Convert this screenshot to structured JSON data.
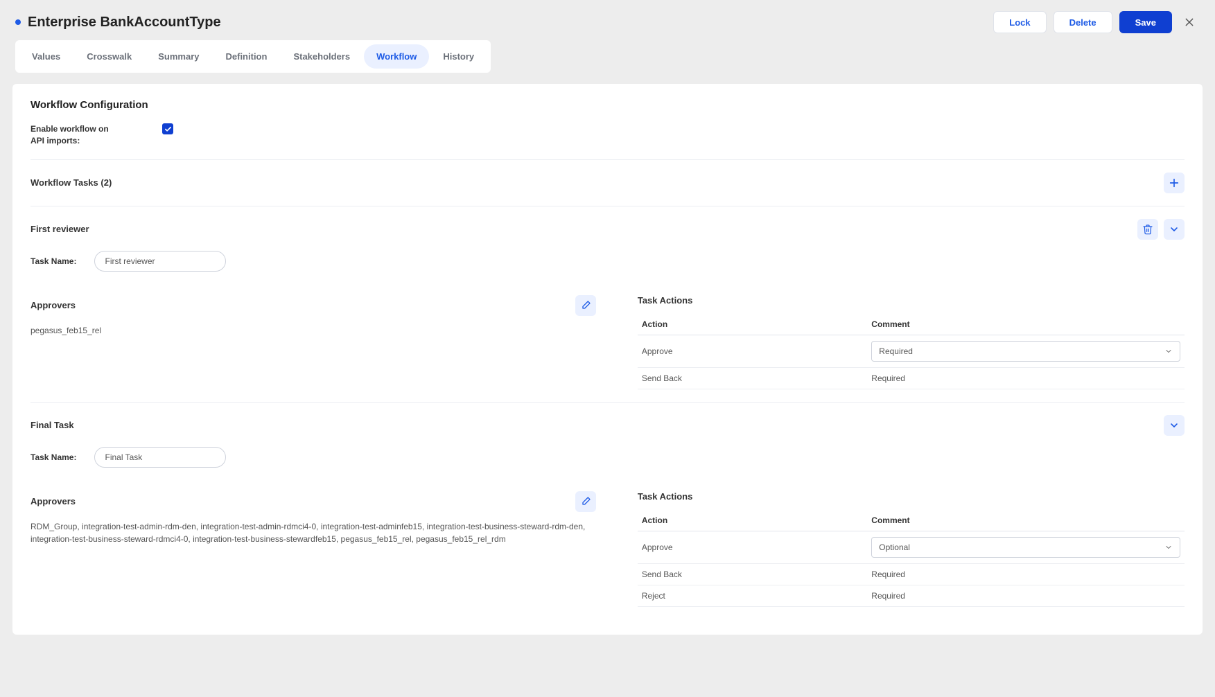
{
  "header": {
    "title": "Enterprise BankAccountType",
    "lock": "Lock",
    "delete": "Delete",
    "save": "Save"
  },
  "tabs": [
    "Values",
    "Crosswalk",
    "Summary",
    "Definition",
    "Stakeholders",
    "Workflow",
    "History"
  ],
  "active_tab_index": 5,
  "panel": {
    "title": "Workflow Configuration",
    "enable_label": "Enable workflow on API imports:",
    "tasks_header": "Workflow Tasks (2)",
    "task_name_label": "Task Name:",
    "approvers_label": "Approvers",
    "task_actions_label": "Task Actions",
    "columns": {
      "action": "Action",
      "comment": "Comment"
    }
  },
  "tasks": [
    {
      "title": "First reviewer",
      "name_value": "First reviewer",
      "approvers": "pegasus_feb15_rel",
      "has_delete": true,
      "actions": [
        {
          "action": "Approve",
          "comment_type": "select",
          "comment_value": "Required"
        },
        {
          "action": "Send Back",
          "comment_type": "text",
          "comment_value": "Required"
        }
      ]
    },
    {
      "title": "Final Task",
      "name_value": "Final Task",
      "approvers": "RDM_Group, integration-test-admin-rdm-den, integration-test-admin-rdmci4-0, integration-test-adminfeb15, integration-test-business-steward-rdm-den, integration-test-business-steward-rdmci4-0, integration-test-business-stewardfeb15, pegasus_feb15_rel, pegasus_feb15_rel_rdm",
      "has_delete": false,
      "actions": [
        {
          "action": "Approve",
          "comment_type": "select",
          "comment_value": "Optional"
        },
        {
          "action": "Send Back",
          "comment_type": "text",
          "comment_value": "Required"
        },
        {
          "action": "Reject",
          "comment_type": "text",
          "comment_value": "Required"
        }
      ]
    }
  ]
}
